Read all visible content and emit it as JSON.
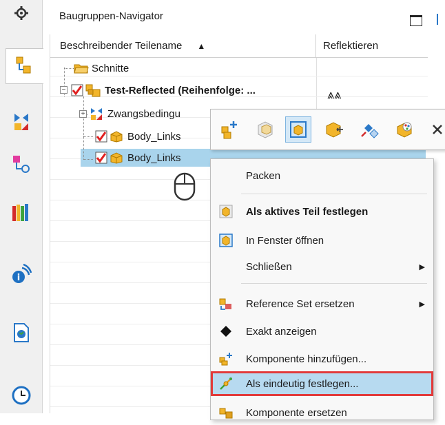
{
  "panel": {
    "title": "Baugruppen-Navigator"
  },
  "columns": {
    "name": "Beschreibender Teilename",
    "reflect": "Reflektieren"
  },
  "tree": {
    "schnitte": "Schnitte",
    "root": "Test-Reflected (Reihenfolge: ...",
    "constraints": "Zwangsbedingu",
    "body1": "Body_Links",
    "body2": "Body_Links",
    "reflect_symbol": "⋀⋀"
  },
  "context_menu": {
    "pack": "Packen",
    "make_work_part": "Als aktives Teil festlegen",
    "open_window": "In Fenster öffnen",
    "close": "Schließen",
    "replace_refset": "Reference Set ersetzen",
    "exact_show": "Exakt anzeigen",
    "add_component": "Komponente hinzufügen...",
    "make_unique": "Als eindeutig festlegen...",
    "replace_component": "Komponente ersetzen"
  },
  "colors": {
    "selection": "#a9d4ec",
    "highlight_border": "#e23b3b",
    "accent": "#2a78c8"
  }
}
